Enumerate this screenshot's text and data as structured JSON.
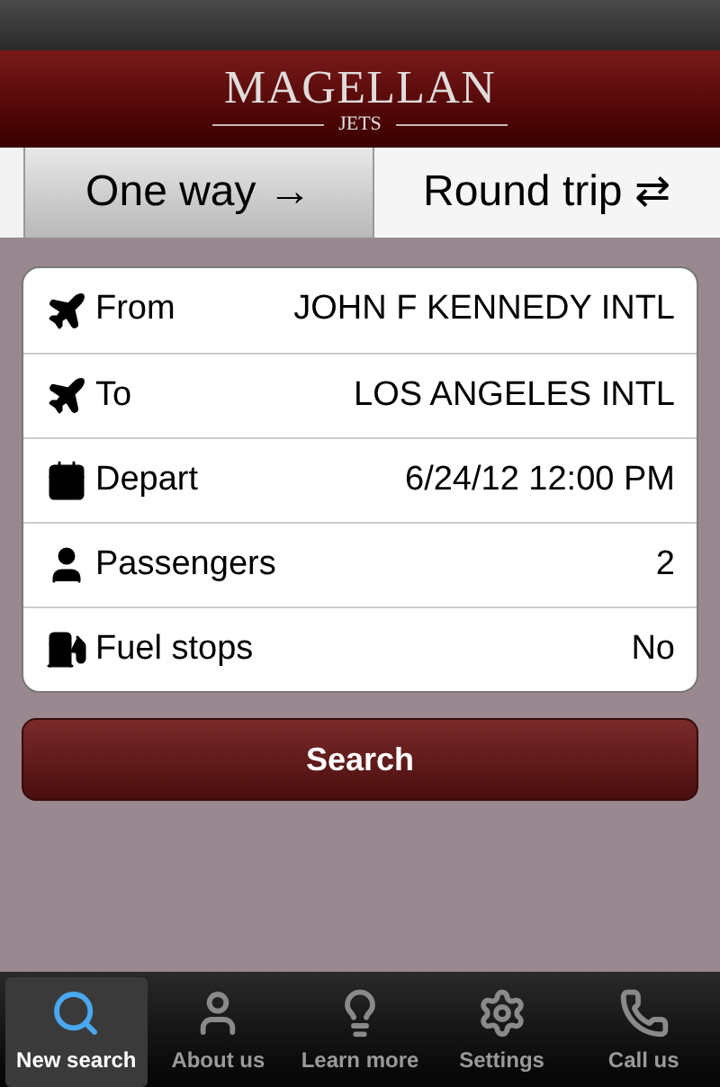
{
  "logo": {
    "name": "MAGELLAN",
    "tagline": "JETS"
  },
  "trip_types": [
    {
      "label": "One way",
      "arrow": "→",
      "selected": true
    },
    {
      "label": "Round trip",
      "arrow": "⇄",
      "selected": false
    }
  ],
  "fields": [
    {
      "kind": "plane",
      "label": "From",
      "value": "JOHN F KENNEDY INTL"
    },
    {
      "kind": "plane",
      "label": "To",
      "value": "LOS ANGELES INTL"
    },
    {
      "kind": "calendar",
      "label": "Depart",
      "value": "6/24/12 12:00 PM"
    },
    {
      "kind": "person",
      "label": "Passengers",
      "value": "2"
    },
    {
      "kind": "fuel",
      "label": "Fuel stops",
      "value": "No"
    }
  ],
  "search_button": "Search",
  "tab_bar": [
    {
      "kind": "search",
      "label": "New search",
      "selected": true
    },
    {
      "kind": "person",
      "label": "About us",
      "selected": false
    },
    {
      "kind": "bulb",
      "label": "Learn more",
      "selected": false
    },
    {
      "kind": "gear",
      "label": "Settings",
      "selected": false
    },
    {
      "kind": "phone",
      "label": "Call us",
      "selected": false
    }
  ]
}
